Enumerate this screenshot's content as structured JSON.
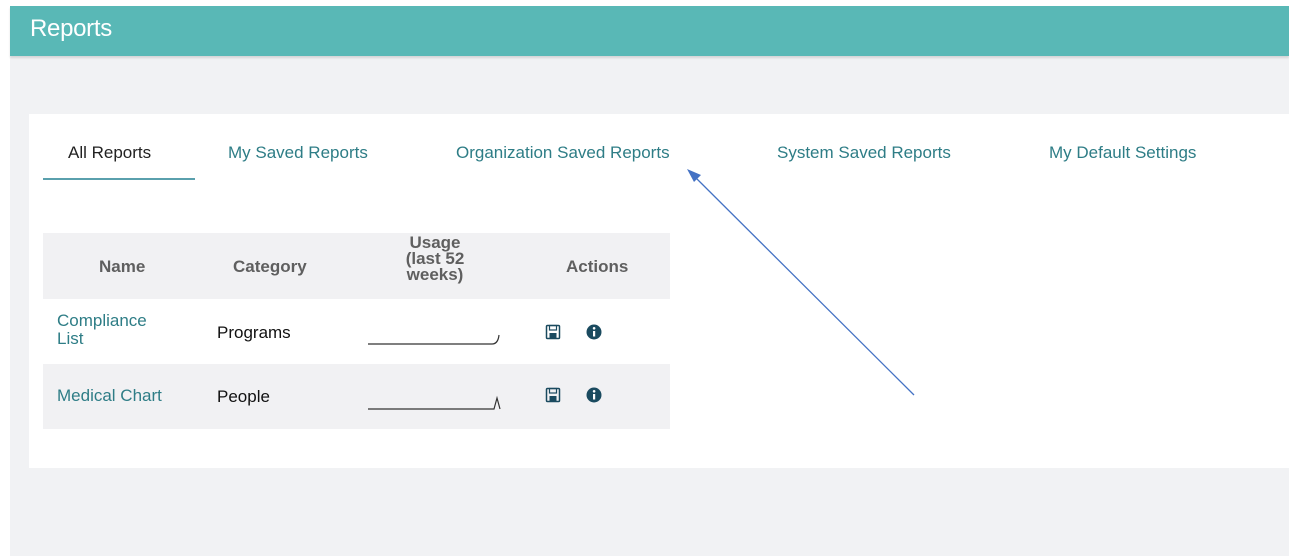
{
  "header": {
    "title": "Reports",
    "background_color": "#59b8b6"
  },
  "tabs": [
    {
      "label": "All Reports",
      "active": true
    },
    {
      "label": "My Saved Reports",
      "active": false
    },
    {
      "label": "Organization Saved Reports",
      "active": false
    },
    {
      "label": "System Saved Reports",
      "active": false
    },
    {
      "label": "My Default Settings",
      "active": false
    }
  ],
  "table": {
    "columns": {
      "name": "Name",
      "category": "Category",
      "usage_line1": "Usage",
      "usage_line2": "(last 52",
      "usage_line3": "weeks)",
      "actions": "Actions"
    },
    "rows": [
      {
        "name_line1": "Compliance",
        "name_line2": "List",
        "category": "Programs",
        "actions": [
          "save-icon",
          "info-icon"
        ]
      },
      {
        "name": "Medical Chart",
        "category": "People",
        "actions": [
          "save-icon",
          "info-icon"
        ]
      }
    ]
  },
  "annotation": {
    "arrow_color": "#4472c4",
    "points_to": "Organization Saved Reports"
  },
  "colors": {
    "link": "#2e7d86",
    "page_background": "#f1f2f4",
    "active_tab_underline": "#5aa0ad"
  }
}
